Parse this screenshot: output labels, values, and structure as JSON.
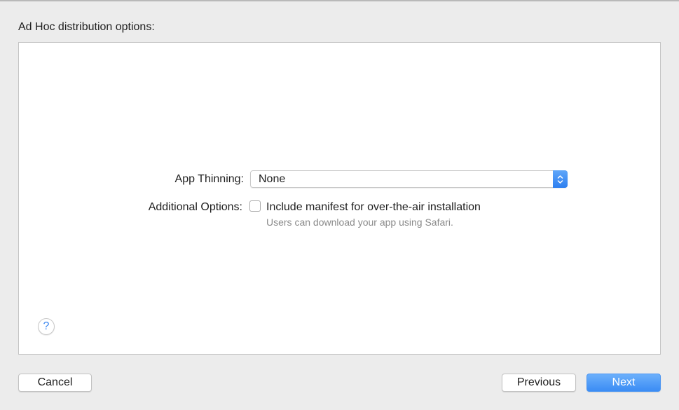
{
  "section_title": "Ad Hoc distribution options:",
  "app_thinning": {
    "label": "App Thinning:",
    "value": "None"
  },
  "additional_options": {
    "label": "Additional Options:",
    "checkbox_label": "Include manifest for over-the-air installation",
    "checkbox_checked": false,
    "help_text": "Users can download your app using Safari."
  },
  "help_button": {
    "symbol": "?"
  },
  "footer": {
    "cancel_label": "Cancel",
    "previous_label": "Previous",
    "next_label": "Next"
  },
  "colors": {
    "accent": "#3b8cf4",
    "window_bg": "#ececec",
    "panel_bg": "#ffffff"
  }
}
